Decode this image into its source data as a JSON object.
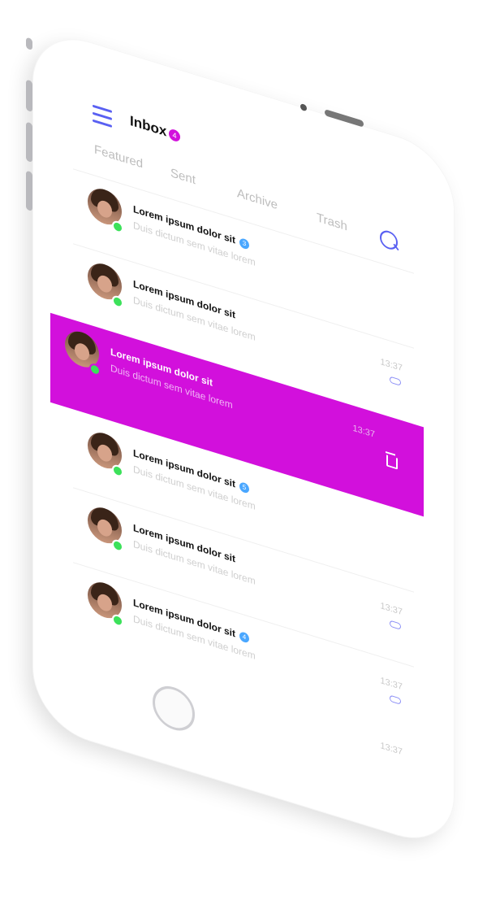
{
  "header": {
    "title": "Inbox",
    "badge": "4"
  },
  "tabs": [
    {
      "label": "Featured"
    },
    {
      "label": "Sent"
    },
    {
      "label": "Archive"
    },
    {
      "label": "Trash"
    }
  ],
  "messages": [
    {
      "subject": "Lorem ipsum dolor sit",
      "preview": "Duis dictum sem vitae lorem",
      "time": "",
      "count": "3",
      "attachment": false
    },
    {
      "subject": "Lorem ipsum dolor sit",
      "preview": "Duis dictum sem vitae lorem",
      "time": "13:37",
      "count": "",
      "attachment": true
    },
    {
      "subject": "Lorem ipsum dolor sit",
      "preview": "Duis dictum sem vitae lorem",
      "time": "13:37",
      "count": "",
      "attachment": false
    },
    {
      "subject": "Lorem ipsum dolor sit",
      "preview": "Duis dictum sem vitae lorem",
      "time": "",
      "count": "5",
      "attachment": false
    },
    {
      "subject": "Lorem ipsum dolor sit",
      "preview": "Duis dictum sem vitae lorem",
      "time": "13:37",
      "count": "",
      "attachment": true
    },
    {
      "subject": "Lorem ipsum dolor sit",
      "preview": "Duis dictum sem vitae lorem",
      "time": "13:37",
      "count": "4",
      "attachment": true
    },
    {
      "subject": "",
      "preview": "",
      "time": "13:37",
      "count": "",
      "attachment": false
    }
  ],
  "colors": {
    "accent": "#d210dc",
    "link": "#5960f2",
    "online": "#3ce15a",
    "count": "#4aa7ff"
  },
  "icons": {
    "menu": "menu-icon",
    "search": "search-icon",
    "trash": "trash-icon",
    "attachment": "paperclip-icon"
  }
}
